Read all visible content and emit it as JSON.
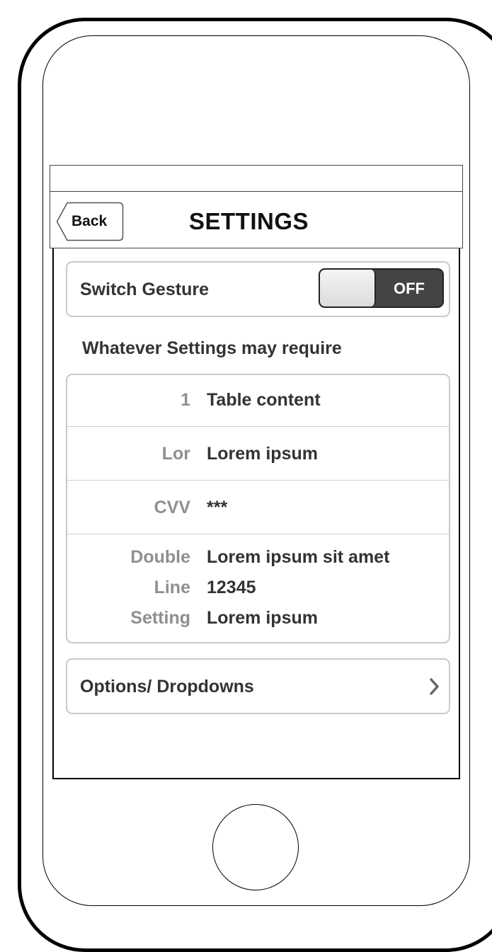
{
  "navbar": {
    "back_label": "Back",
    "title": "SETTINGS"
  },
  "switch_setting": {
    "label": "Switch Gesture",
    "toggle_state": "OFF"
  },
  "section_header": "Whatever Settings may require",
  "table": {
    "rows": [
      {
        "key": "1",
        "value": "Table content"
      },
      {
        "key": "Lor",
        "value": "Lorem ipsum"
      },
      {
        "key": "CVV",
        "value": "***"
      }
    ],
    "multi_row": {
      "keys": [
        "Double",
        "Line",
        "Setting"
      ],
      "values": [
        "Lorem ipsum sit amet",
        "12345",
        "Lorem ipsum"
      ]
    }
  },
  "options": {
    "label": "Options/ Dropdowns",
    "chevron_icon": "chevron-right-icon"
  },
  "colors": {
    "toggle_off_bg": "#444444",
    "card_border": "#c9c9c9",
    "key_text": "#8f8f8f"
  }
}
